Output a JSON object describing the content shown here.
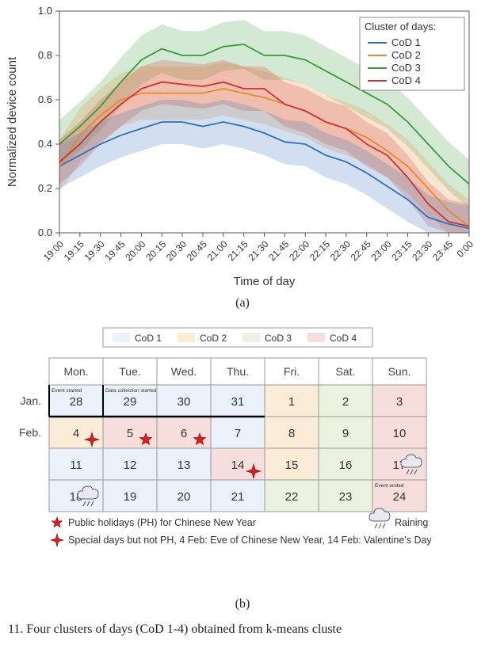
{
  "colors": {
    "cod1": "#2f6fbf",
    "cod2": "#e58b2e",
    "cod3": "#3a9a3a",
    "cod4": "#cf3232",
    "cod1_fill": "#eaf1fa",
    "cod2_fill": "#faecd7",
    "cod3_fill": "#eaf3df",
    "cod4_fill": "#f6dedc",
    "frame": "#585858",
    "grid": "#dddddd",
    "text": "#333333"
  },
  "chart_data": {
    "type": "line",
    "title": "",
    "xlabel": "Time of day",
    "ylabel": "Normalized device count",
    "ylim": [
      0.0,
      1.0
    ],
    "categories": [
      "19:00",
      "19:15",
      "19:30",
      "19:45",
      "20:00",
      "20:15",
      "20:30",
      "20:45",
      "21:00",
      "21:15",
      "21:30",
      "21:45",
      "22:00",
      "22:15",
      "22:30",
      "22:45",
      "23:00",
      "23:15",
      "23:30",
      "23:45",
      "0:00"
    ],
    "legend_title": "Cluster of days:",
    "series": [
      {
        "name": "CoD 1",
        "color_key": "cod1",
        "values": [
          0.3,
          0.35,
          0.4,
          0.44,
          0.47,
          0.5,
          0.5,
          0.48,
          0.5,
          0.48,
          0.45,
          0.41,
          0.4,
          0.35,
          0.32,
          0.27,
          0.21,
          0.15,
          0.07,
          0.04,
          0.02
        ],
        "band": 0.1
      },
      {
        "name": "CoD 2",
        "color_key": "cod2",
        "values": [
          0.3,
          0.44,
          0.53,
          0.6,
          0.63,
          0.63,
          0.63,
          0.63,
          0.65,
          0.63,
          0.61,
          0.58,
          0.55,
          0.5,
          0.47,
          0.43,
          0.37,
          0.3,
          0.2,
          0.1,
          0.03
        ],
        "band": 0.12
      },
      {
        "name": "CoD 3",
        "color_key": "cod3",
        "values": [
          0.4,
          0.48,
          0.57,
          0.68,
          0.78,
          0.83,
          0.8,
          0.8,
          0.84,
          0.85,
          0.8,
          0.8,
          0.78,
          0.73,
          0.68,
          0.63,
          0.58,
          0.5,
          0.4,
          0.3,
          0.22
        ],
        "band": 0.11
      },
      {
        "name": "CoD 4",
        "color_key": "cod4",
        "values": [
          0.32,
          0.4,
          0.5,
          0.58,
          0.65,
          0.68,
          0.67,
          0.66,
          0.68,
          0.65,
          0.65,
          0.58,
          0.55,
          0.5,
          0.47,
          0.4,
          0.35,
          0.25,
          0.13,
          0.05,
          0.03
        ],
        "band": 0.1
      }
    ]
  },
  "subfig_a": "(a)",
  "subfig_b": "(b)",
  "calendar": {
    "legend": [
      "CoD 1",
      "CoD 2",
      "CoD 3",
      "CoD 4"
    ],
    "days": [
      "Mon.",
      "Tue.",
      "Wed.",
      "Thu.",
      "Fri.",
      "Sat.",
      "Sun."
    ],
    "months": [
      "Jan.",
      "Feb."
    ],
    "rows": [
      [
        {
          "n": 28,
          "c": 1,
          "note": "Event started"
        },
        {
          "n": 29,
          "c": 1,
          "note": "Data collection started"
        },
        {
          "n": 30,
          "c": 1
        },
        {
          "n": 31,
          "c": 1
        },
        {
          "n": 1,
          "c": 2
        },
        {
          "n": 2,
          "c": 3
        },
        {
          "n": 3,
          "c": 4
        }
      ],
      [
        {
          "n": 4,
          "c": 2,
          "sp": true
        },
        {
          "n": 5,
          "c": 4,
          "ph": true
        },
        {
          "n": 6,
          "c": 4,
          "ph": true
        },
        {
          "n": 7,
          "c": 1
        },
        {
          "n": 8,
          "c": 2
        },
        {
          "n": 9,
          "c": 3
        },
        {
          "n": 10,
          "c": 4
        }
      ],
      [
        {
          "n": 11,
          "c": 1
        },
        {
          "n": 12,
          "c": 1
        },
        {
          "n": 13,
          "c": 1
        },
        {
          "n": 14,
          "c": 4,
          "sp": true
        },
        {
          "n": 15,
          "c": 2
        },
        {
          "n": 16,
          "c": 3
        },
        {
          "n": 17,
          "c": 4,
          "rain": true
        }
      ],
      [
        {
          "n": 18,
          "c": 1,
          "rain": true
        },
        {
          "n": 19,
          "c": 1
        },
        {
          "n": 20,
          "c": 1
        },
        {
          "n": 21,
          "c": 1
        },
        {
          "n": 22,
          "c": 3
        },
        {
          "n": 23,
          "c": 3
        },
        {
          "n": 24,
          "c": 4,
          "note": "Event ended"
        }
      ]
    ],
    "notes": {
      "ph": "Public holidays (PH) for Chinese New Year",
      "rain": "Raining",
      "sp": "Special days but not PH, 4 Feb: Eve of Chinese New Year, 14 Feb: Valentine's Day"
    }
  },
  "caption_fragment": "11.   Four clusters of days (CoD 1-4) obtained from k-means cluste"
}
